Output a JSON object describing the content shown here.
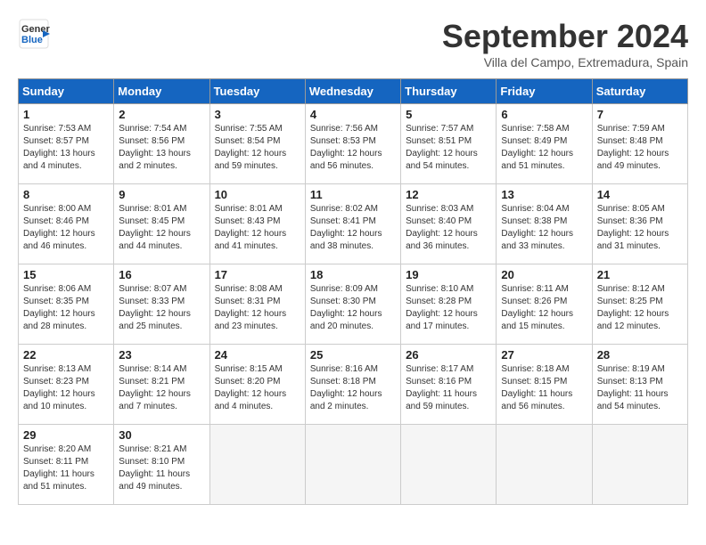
{
  "header": {
    "logo_general": "General",
    "logo_blue": "Blue",
    "month_year": "September 2024",
    "location": "Villa del Campo, Extremadura, Spain"
  },
  "weekdays": [
    "Sunday",
    "Monday",
    "Tuesday",
    "Wednesday",
    "Thursday",
    "Friday",
    "Saturday"
  ],
  "weeks": [
    [
      {
        "day": 1,
        "info": "Sunrise: 7:53 AM\nSunset: 8:57 PM\nDaylight: 13 hours\nand 4 minutes."
      },
      {
        "day": 2,
        "info": "Sunrise: 7:54 AM\nSunset: 8:56 PM\nDaylight: 13 hours\nand 2 minutes."
      },
      {
        "day": 3,
        "info": "Sunrise: 7:55 AM\nSunset: 8:54 PM\nDaylight: 12 hours\nand 59 minutes."
      },
      {
        "day": 4,
        "info": "Sunrise: 7:56 AM\nSunset: 8:53 PM\nDaylight: 12 hours\nand 56 minutes."
      },
      {
        "day": 5,
        "info": "Sunrise: 7:57 AM\nSunset: 8:51 PM\nDaylight: 12 hours\nand 54 minutes."
      },
      {
        "day": 6,
        "info": "Sunrise: 7:58 AM\nSunset: 8:49 PM\nDaylight: 12 hours\nand 51 minutes."
      },
      {
        "day": 7,
        "info": "Sunrise: 7:59 AM\nSunset: 8:48 PM\nDaylight: 12 hours\nand 49 minutes."
      }
    ],
    [
      {
        "day": 8,
        "info": "Sunrise: 8:00 AM\nSunset: 8:46 PM\nDaylight: 12 hours\nand 46 minutes."
      },
      {
        "day": 9,
        "info": "Sunrise: 8:01 AM\nSunset: 8:45 PM\nDaylight: 12 hours\nand 44 minutes."
      },
      {
        "day": 10,
        "info": "Sunrise: 8:01 AM\nSunset: 8:43 PM\nDaylight: 12 hours\nand 41 minutes."
      },
      {
        "day": 11,
        "info": "Sunrise: 8:02 AM\nSunset: 8:41 PM\nDaylight: 12 hours\nand 38 minutes."
      },
      {
        "day": 12,
        "info": "Sunrise: 8:03 AM\nSunset: 8:40 PM\nDaylight: 12 hours\nand 36 minutes."
      },
      {
        "day": 13,
        "info": "Sunrise: 8:04 AM\nSunset: 8:38 PM\nDaylight: 12 hours\nand 33 minutes."
      },
      {
        "day": 14,
        "info": "Sunrise: 8:05 AM\nSunset: 8:36 PM\nDaylight: 12 hours\nand 31 minutes."
      }
    ],
    [
      {
        "day": 15,
        "info": "Sunrise: 8:06 AM\nSunset: 8:35 PM\nDaylight: 12 hours\nand 28 minutes."
      },
      {
        "day": 16,
        "info": "Sunrise: 8:07 AM\nSunset: 8:33 PM\nDaylight: 12 hours\nand 25 minutes."
      },
      {
        "day": 17,
        "info": "Sunrise: 8:08 AM\nSunset: 8:31 PM\nDaylight: 12 hours\nand 23 minutes."
      },
      {
        "day": 18,
        "info": "Sunrise: 8:09 AM\nSunset: 8:30 PM\nDaylight: 12 hours\nand 20 minutes."
      },
      {
        "day": 19,
        "info": "Sunrise: 8:10 AM\nSunset: 8:28 PM\nDaylight: 12 hours\nand 17 minutes."
      },
      {
        "day": 20,
        "info": "Sunrise: 8:11 AM\nSunset: 8:26 PM\nDaylight: 12 hours\nand 15 minutes."
      },
      {
        "day": 21,
        "info": "Sunrise: 8:12 AM\nSunset: 8:25 PM\nDaylight: 12 hours\nand 12 minutes."
      }
    ],
    [
      {
        "day": 22,
        "info": "Sunrise: 8:13 AM\nSunset: 8:23 PM\nDaylight: 12 hours\nand 10 minutes."
      },
      {
        "day": 23,
        "info": "Sunrise: 8:14 AM\nSunset: 8:21 PM\nDaylight: 12 hours\nand 7 minutes."
      },
      {
        "day": 24,
        "info": "Sunrise: 8:15 AM\nSunset: 8:20 PM\nDaylight: 12 hours\nand 4 minutes."
      },
      {
        "day": 25,
        "info": "Sunrise: 8:16 AM\nSunset: 8:18 PM\nDaylight: 12 hours\nand 2 minutes."
      },
      {
        "day": 26,
        "info": "Sunrise: 8:17 AM\nSunset: 8:16 PM\nDaylight: 11 hours\nand 59 minutes."
      },
      {
        "day": 27,
        "info": "Sunrise: 8:18 AM\nSunset: 8:15 PM\nDaylight: 11 hours\nand 56 minutes."
      },
      {
        "day": 28,
        "info": "Sunrise: 8:19 AM\nSunset: 8:13 PM\nDaylight: 11 hours\nand 54 minutes."
      }
    ],
    [
      {
        "day": 29,
        "info": "Sunrise: 8:20 AM\nSunset: 8:11 PM\nDaylight: 11 hours\nand 51 minutes."
      },
      {
        "day": 30,
        "info": "Sunrise: 8:21 AM\nSunset: 8:10 PM\nDaylight: 11 hours\nand 49 minutes."
      },
      null,
      null,
      null,
      null,
      null
    ]
  ]
}
